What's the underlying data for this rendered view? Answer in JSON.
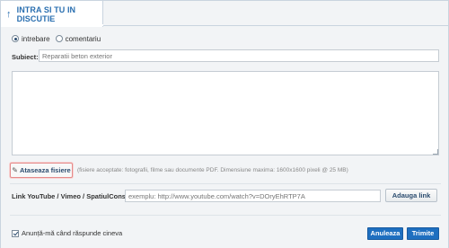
{
  "tab": {
    "label": "INTRA SI TU IN DISCUTIE",
    "icon": "arrow-up-icon"
  },
  "post_type": {
    "options": [
      {
        "label": "intrebare",
        "selected": true
      },
      {
        "label": "comentariu",
        "selected": false
      }
    ]
  },
  "subject": {
    "label": "Subiect:",
    "placeholder": "Reparatii beton exterior"
  },
  "message": {
    "value": ""
  },
  "attachments": {
    "button_label": "Ataseaza fisiere",
    "icon": "paperclip-icon",
    "hint": "(fisiere acceptate: fotografii, filme sau documente PDF. Dimensiune maxima: 1600x1600 pixeli @ 25 MB)"
  },
  "link": {
    "label": "Link YouTube / Vimeo / SpatiulConstruit:",
    "placeholder": "exemplu: http://www.youtube.com/watch?v=DOryEhRTP7A",
    "add_button": "Adauga link"
  },
  "notify": {
    "label": "Anunță-mă când răspunde cineva",
    "checked": true
  },
  "actions": {
    "cancel": "Anuleaza",
    "submit": "Trimite"
  },
  "colors": {
    "accent": "#1e6fc0",
    "tab_text": "#2a6fb0",
    "panel_bg": "#f2f4f6",
    "attach_highlight": "#e58a8a"
  }
}
